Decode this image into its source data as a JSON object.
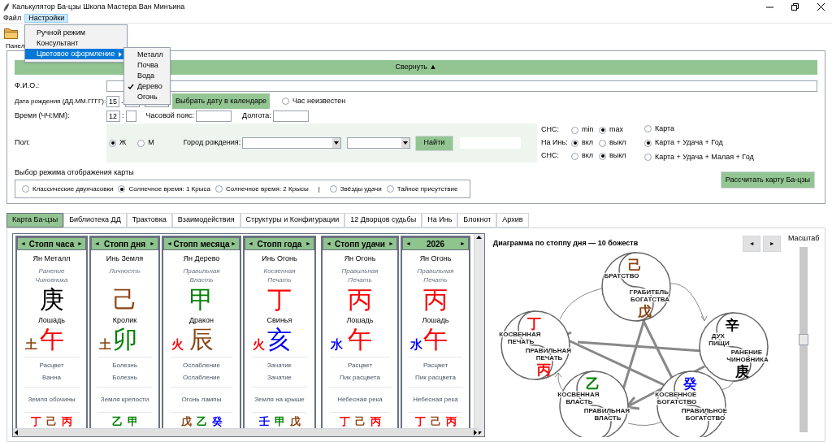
{
  "window": {
    "title": "Калькулятор Ба-цзы Школа Мастера Ван Минъина"
  },
  "menu_bar": [
    {
      "label": "Файл",
      "selected": false
    },
    {
      "label": "Настройки",
      "selected": true
    }
  ],
  "settings_menu": [
    {
      "label": "Ручной режим",
      "selected": false,
      "has_submenu": false
    },
    {
      "label": "Консультант",
      "selected": false,
      "has_submenu": false
    },
    {
      "label": "Цветовое оформление",
      "selected": true,
      "has_submenu": true
    }
  ],
  "color_theme_menu": [
    {
      "label": "Металл",
      "checked": false
    },
    {
      "label": "Почва",
      "checked": false
    },
    {
      "label": "Вода",
      "checked": false
    },
    {
      "label": "Дерево",
      "checked": true
    },
    {
      "label": "Огонь",
      "checked": false
    }
  ],
  "panel_label": "Панел",
  "collapse_button": "Свернуть ▲",
  "form": {
    "name_label": "Ф.И.О.:",
    "birth_date_label": "Дата рождения (ДД.ММ.ГГГГ):",
    "day": "15",
    "date_separator": ".",
    "calendar_button": "Выбрать дату в календаре",
    "unknown_hour": {
      "label": "Час неизвестен",
      "checked": false
    },
    "time_label": "Время (ЧЧ:ММ):",
    "hour": "12",
    "time_separator": ":",
    "timezone_label": "Часовой пояс:",
    "longitude_label": "Долгота:",
    "gender_label": "Пол:",
    "gender_options": [
      {
        "label": "Ж",
        "selected": true
      },
      {
        "label": "М",
        "selected": false
      }
    ],
    "city_label": "Город рождения:",
    "find_button": "Найти"
  },
  "toggles": [
    {
      "label": "СНС:",
      "options": [
        {
          "label": "min",
          "selected": false
        },
        {
          "label": "max",
          "selected": true
        }
      ]
    },
    {
      "label": "На Инь:",
      "options": [
        {
          "label": "вкл",
          "selected": true
        },
        {
          "label": "выкл",
          "selected": false
        }
      ]
    },
    {
      "label": "СНС:",
      "options": [
        {
          "label": "вкл",
          "selected": false
        },
        {
          "label": "выкл",
          "selected": true
        }
      ]
    }
  ],
  "chart_scope": [
    {
      "label": "Карта",
      "selected": false
    },
    {
      "label": "Карта + Удача + Год",
      "selected": true
    },
    {
      "label": "Карта + Удача + Малая + Год",
      "selected": false
    }
  ],
  "display_mode": {
    "label": "Выбор режима отображения карты",
    "options": [
      {
        "kind": "radio",
        "label": "Классические двухчасовки",
        "selected": false
      },
      {
        "kind": "radio",
        "label": "Солнечное время: 1 Крыса",
        "selected": true
      },
      {
        "kind": "radio",
        "label": "Солнечное время: 2 Крысы",
        "selected": false
      },
      {
        "kind": "separator",
        "label": "|"
      },
      {
        "kind": "radio",
        "label": "Звёзды удачи",
        "selected": false
      },
      {
        "kind": "radio",
        "label": "Тайное присутствие",
        "selected": false
      }
    ]
  },
  "calculate_button": "Рассчитать карту Ба-цзы",
  "tabs": [
    {
      "label": "Карта Ба-цзы",
      "selected": true
    },
    {
      "label": "Библиотека ДД",
      "selected": false
    },
    {
      "label": "Трактовка",
      "selected": false
    },
    {
      "label": "Взаимодействия",
      "selected": false
    },
    {
      "label": "Структуры и Конфигурации",
      "selected": false
    },
    {
      "label": "12 Дворцов судьбы",
      "selected": false
    },
    {
      "label": "На Инь",
      "selected": false
    },
    {
      "label": "Блокнот",
      "selected": false
    },
    {
      "label": "Архив",
      "selected": false
    }
  ],
  "pillars": [
    {
      "prev": "◄",
      "title": "Стопп часа",
      "next": "►",
      "stem_label": "Ян Металл",
      "ten_god": "Ранение Чиновника",
      "stem": {
        "char": "庚",
        "color": "#000000"
      },
      "animal": "Лошадь",
      "branch_element": {
        "char": "土",
        "color": "#8b4513"
      },
      "branch": {
        "char": "午",
        "color": "#ff0000"
      },
      "stage_1": "Расцвет",
      "stage_2": "Ванна",
      "nayin": "Земля обочины",
      "hidden": [
        {
          "char": "丁",
          "color": "#ff0000"
        },
        {
          "char": "己",
          "color": "#8b4513"
        },
        {
          "char": "丙",
          "color": "#ff0000"
        }
      ]
    },
    {
      "prev": "◄",
      "title": "Стопп дня",
      "next": "►",
      "stem_label": "Инь Земля",
      "ten_god": "Личность",
      "stem": {
        "char": "己",
        "color": "#8b4513"
      },
      "animal": "Кролик",
      "branch_element": {
        "char": "土",
        "color": "#8b4513"
      },
      "branch": {
        "char": "卯",
        "color": "#008000"
      },
      "stage_1": "Болезнь",
      "stage_2": "Болезнь",
      "nayin": "Земля крепости",
      "hidden": [
        {
          "char": "乙",
          "color": "#008000"
        },
        {
          "char": "甲",
          "color": "#008000"
        }
      ]
    },
    {
      "prev": "◄",
      "title": "Стопп месяца",
      "next": "►",
      "stem_label": "Ян Дерево",
      "ten_god": "Правильная Власть",
      "stem": {
        "char": "甲",
        "color": "#008000"
      },
      "animal": "Дракон",
      "branch_element": {
        "char": "火",
        "color": "#ff0000"
      },
      "branch": {
        "char": "辰",
        "color": "#8b4513"
      },
      "stage_1": "Ослабление",
      "stage_2": "Ослабление",
      "nayin": "Огонь лампы",
      "hidden": [
        {
          "char": "戊",
          "color": "#8b4513"
        },
        {
          "char": "乙",
          "color": "#008000"
        },
        {
          "char": "癸",
          "color": "#0000ff"
        }
      ]
    },
    {
      "prev": "◄",
      "title": "Стопп года",
      "next": "►",
      "stem_label": "Инь Огонь",
      "ten_god": "Косвенная Печать",
      "stem": {
        "char": "丁",
        "color": "#ff0000"
      },
      "animal": "Свинья",
      "branch_element": {
        "char": "火",
        "color": "#ff0000"
      },
      "branch": {
        "char": "亥",
        "color": "#0000ff"
      },
      "stage_1": "Зачатие",
      "stage_2": "Зачатие",
      "nayin": "Земля на крыше",
      "hidden": [
        {
          "char": "壬",
          "color": "#0000ff"
        },
        {
          "char": "甲",
          "color": "#008000"
        },
        {
          "char": "戊",
          "color": "#8b4513"
        }
      ]
    },
    {
      "prev": "◄",
      "title": "Стопп удачи",
      "next": "►",
      "stem_label": "Ян Огонь",
      "ten_god": "Правильная Печать",
      "stem": {
        "char": "丙",
        "color": "#ff0000"
      },
      "animal": "Лошадь",
      "branch_element": {
        "char": "水",
        "color": "#0000ff"
      },
      "branch": {
        "char": "午",
        "color": "#ff0000"
      },
      "stage_1": "Расцвет",
      "stage_2": "Пик расцвета",
      "nayin": "Небесная река",
      "hidden": [
        {
          "char": "丁",
          "color": "#ff0000"
        },
        {
          "char": "己",
          "color": "#8b4513"
        },
        {
          "char": "丙",
          "color": "#ff0000"
        }
      ]
    },
    {
      "prev": "◄",
      "title": "2026",
      "next": "►",
      "stem_label": "Ян Огонь",
      "ten_god": "Правильная Печать",
      "stem": {
        "char": "丙",
        "color": "#ff0000"
      },
      "animal": "Лошадь",
      "branch_element": {
        "char": "水",
        "color": "#0000ff"
      },
      "branch": {
        "char": "午",
        "color": "#ff0000"
      },
      "stage_1": "Расцвет",
      "stage_2": "Пик расцвета",
      "nayin": "Небесная река",
      "hidden": [
        {
          "char": "丁",
          "color": "#ff0000"
        },
        {
          "char": "己",
          "color": "#8b4513"
        },
        {
          "char": "丙",
          "color": "#ff0000"
        }
      ]
    }
  ],
  "diagram": {
    "title": "Диаграмма по стоппу дня — 10 божеств",
    "prev": "◄",
    "next": "►",
    "zoom_label": "Масштаб",
    "zoom": {
      "level": 0.5
    },
    "nodes": [
      {
        "top": {
          "char": "己",
          "color": "#8b4513"
        },
        "label_top": "БРАТСТВО",
        "label_bottom": "ГРАБИТЕЛЬ БОГАТСТВА",
        "bottom": {
          "char": "戊",
          "color": "#8b4513"
        }
      },
      {
        "top": {
          "char": "丁",
          "color": "#ff0000"
        },
        "label_top": "КОСВЕННАЯ ПЕЧАТЬ",
        "label_bottom": "ПРАВИЛЬНАЯ ПЕЧАТЬ",
        "bottom": {
          "char": "丙",
          "color": "#ff0000"
        }
      },
      {
        "top": {
          "char": "辛",
          "color": "#000000"
        },
        "label_top": "ДУХ ПИЩИ",
        "label_bottom": "РАНЕНИЕ ЧИНОВНИКА",
        "bottom": {
          "char": "庚",
          "color": "#000000"
        }
      },
      {
        "top": {
          "char": "乙",
          "color": "#008000"
        },
        "label_top": "КОСВЕННАЯ ВЛАСТЬ",
        "label_bottom": "ПРАВИЛЬНАЯ ВЛАСТЬ"
      },
      {
        "top": {
          "char": "癸",
          "color": "#0000ff"
        },
        "label_top": "КОСВЕННОЕ БОГАТСТВО",
        "label_bottom": "ПРАВИЛЬНОЕ БОГАТСТВО"
      }
    ]
  }
}
